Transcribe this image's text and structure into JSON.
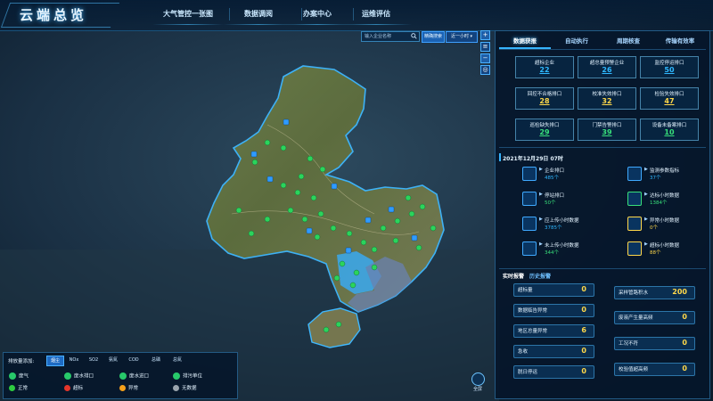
{
  "header": {
    "app_title": "云端总览",
    "nav_tabs": [
      "大气管控一张图",
      "数据调阅",
      "办案中心",
      "运维评估"
    ]
  },
  "search": {
    "placeholder": "输入企业名称",
    "search_button": "精确搜索",
    "time_select": "近一小时"
  },
  "map_controls": {
    "zoom_in": "+",
    "zoom_out": "−"
  },
  "right_panel": {
    "tabs": [
      "数据获报",
      "自动执行",
      "周期核查",
      "传输有效率"
    ],
    "active_tab": 0,
    "stats": [
      {
        "label": "超标企业",
        "value": "22",
        "color": "#2fb8ff"
      },
      {
        "label": "超总量预警企业",
        "value": "26",
        "color": "#2fb8ff"
      },
      {
        "label": "监控停运排口",
        "value": "50",
        "color": "#2fb8ff"
      },
      {
        "label": "回控不合格排口",
        "value": "28",
        "color": "#ffd84a"
      },
      {
        "label": "校准失效排口",
        "value": "32",
        "color": "#ffd84a"
      },
      {
        "label": "检验失效排口",
        "value": "47",
        "color": "#ffd84a"
      },
      {
        "label": "巡检缺失排口",
        "value": "29",
        "color": "#38e07b"
      },
      {
        "label": "门禁告警排口",
        "value": "39",
        "color": "#38e07b"
      },
      {
        "label": "设备未备案排口",
        "value": "10",
        "color": "#38e07b"
      }
    ],
    "date_label": "2021年12月29日 07时",
    "metrics": [
      {
        "label": "企业排口",
        "value": "485个",
        "color": "#2fb8ff"
      },
      {
        "label": "监测参数指标",
        "value": "37个",
        "color": "#2fb8ff"
      },
      {
        "label": "停站排口",
        "value": "50个",
        "color": "#38e07b"
      },
      {
        "label": "达标小时数据",
        "value": "1384个",
        "color": "#38e07b"
      },
      {
        "label": "应上传小时数据",
        "value": "3785个",
        "color": "#2fb8ff"
      },
      {
        "label": "异常小时数据",
        "value": "0个",
        "color": "#ffd84a"
      },
      {
        "label": "未上传小时数据",
        "value": "344个",
        "color": "#38e07b"
      },
      {
        "label": "超标小时数据",
        "value": "88个",
        "color": "#ffd84a"
      }
    ],
    "alarm_tabs": [
      "实时报警",
      "历史报警"
    ],
    "alarms_left": [
      {
        "label": "超标量",
        "value": "0"
      },
      {
        "label": "数据临告异常",
        "value": "0"
      },
      {
        "label": "地区总量异常",
        "value": "6"
      },
      {
        "label": "急收",
        "value": "0"
      },
      {
        "label": "脱日停运",
        "value": "0"
      }
    ],
    "alarms_right": [
      {
        "label": "采样管路积水",
        "value": "200"
      },
      {
        "label": "废液产生量高频",
        "value": "0"
      },
      {
        "label": "工况不符",
        "value": "0"
      },
      {
        "label": "校验值超高频",
        "value": "0"
      }
    ]
  },
  "legend": {
    "title": "排放量添加:",
    "pollutant_tabs": [
      "烟尘",
      "NOx",
      "SO2",
      "氨氮",
      "COD",
      "总磷",
      "总氮"
    ],
    "active_pollutant": 0,
    "types": [
      {
        "label": "废气",
        "icon": "gas-icon"
      },
      {
        "label": "废水排口",
        "icon": "wastewater-outlet-icon"
      },
      {
        "label": "废水进口",
        "icon": "wastewater-inlet-icon"
      },
      {
        "label": "排污单位",
        "icon": "polluter-icon"
      }
    ],
    "statuses": [
      {
        "label": "正常",
        "color": "#2ecc40"
      },
      {
        "label": "超标",
        "color": "#e5352a"
      },
      {
        "label": "异常",
        "color": "#f5a01a"
      },
      {
        "label": "无数据",
        "color": "#9aa4ad"
      }
    ]
  },
  "fullscreen": {
    "label": "全屏"
  },
  "colors": {
    "accent": "#36b4ff",
    "normal": "#2ecc40",
    "warning": "#ffd84a"
  }
}
